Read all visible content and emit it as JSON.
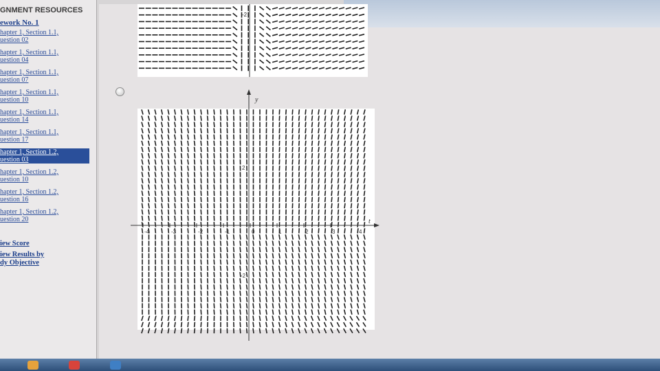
{
  "sidebar": {
    "heading": "GNMENT RESOURCES",
    "homework_title": "ework No. 1",
    "items": [
      {
        "line1": "hapter 1, Section 1.1,",
        "line2": "uestion 02",
        "active": false
      },
      {
        "line1": "hapter 1, Section 1.1,",
        "line2": "uestion 04",
        "active": false
      },
      {
        "line1": "hapter 1, Section 1.1,",
        "line2": "uestion 07",
        "active": false
      },
      {
        "line1": "hapter 1, Section 1.1,",
        "line2": "uestion 10",
        "active": false
      },
      {
        "line1": "hapter 1, Section 1.1,",
        "line2": "uestion 14",
        "active": false
      },
      {
        "line1": "hapter 1, Section 1.1,",
        "line2": "uestion 17",
        "active": false
      },
      {
        "line1": "hapter 1, Section 1.2,",
        "line2": "uestion 03",
        "active": true
      },
      {
        "line1": "hapter 1, Section 1.2,",
        "line2": "uestion 10",
        "active": false
      },
      {
        "line1": "hapter 1, Section 1.2,",
        "line2": "uestion 16",
        "active": false
      },
      {
        "line1": "hapter 1, Section 1.2,",
        "line2": "uestion 20",
        "active": false
      }
    ],
    "view_score": "iew Score",
    "view_results_line1": "iew Results by",
    "view_results_line2": "dy Objective"
  },
  "top_plot": {
    "y_tick_label": "-2"
  },
  "main_plot": {
    "x_axis_label": "t",
    "y_axis_label": "y",
    "x_tick_labels": [
      "-4",
      "-3",
      "-2",
      "-1",
      "0",
      "1",
      "2",
      "3",
      "4"
    ],
    "y_tick_labels": [
      "2",
      "-2"
    ]
  },
  "answer_choice": {
    "selected": false
  }
}
